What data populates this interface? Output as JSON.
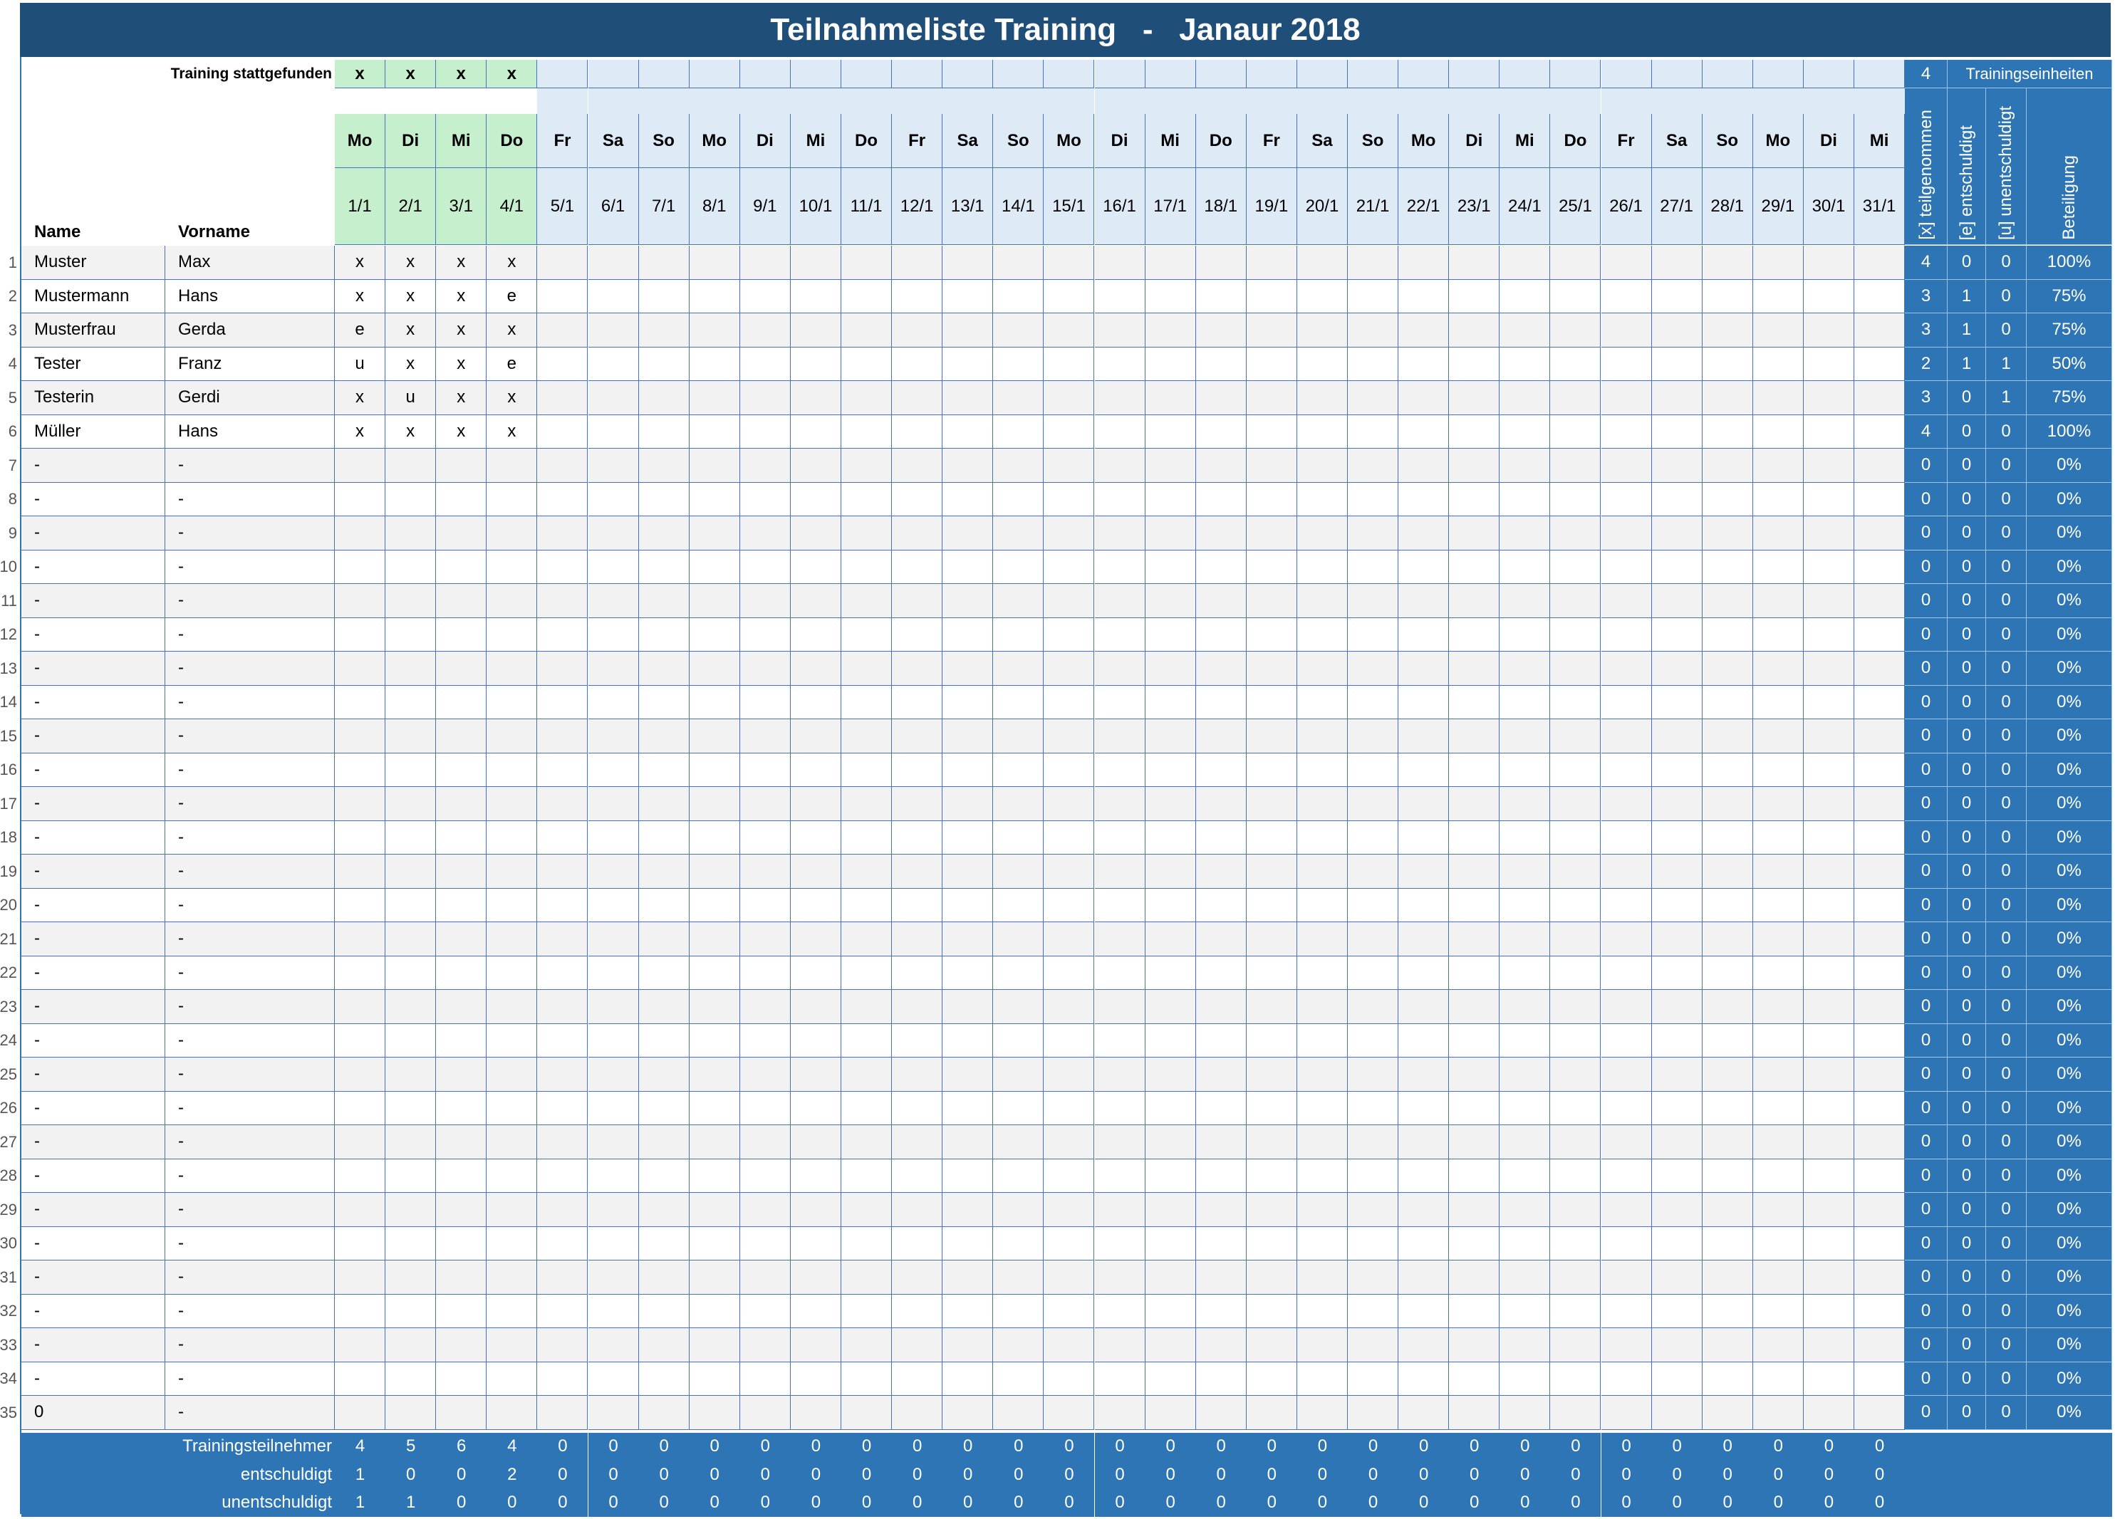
{
  "title": "Teilnahmeliste Training   -   Janaur 2018",
  "header": {
    "training_held_label": "Training stattgefunden",
    "training_units_count": "4",
    "training_units_label": "Trainingseinheiten",
    "name_label": "Name",
    "firstname_label": "Vorname"
  },
  "held_marks": [
    "x",
    "x",
    "x",
    "x"
  ],
  "weekdays": [
    "Mo",
    "Di",
    "Mi",
    "Do",
    "Fr",
    "Sa",
    "So",
    "Mo",
    "Di",
    "Mi",
    "Do",
    "Fr",
    "Sa",
    "So",
    "Mo",
    "Di",
    "Mi",
    "Do",
    "Fr",
    "Sa",
    "So",
    "Mo",
    "Di",
    "Mi",
    "Do",
    "Fr",
    "Sa",
    "So",
    "Mo",
    "Di",
    "Mi"
  ],
  "dates": [
    "1/1",
    "2/1",
    "3/1",
    "4/1",
    "5/1",
    "6/1",
    "7/1",
    "8/1",
    "9/1",
    "10/1",
    "11/1",
    "12/1",
    "13/1",
    "14/1",
    "15/1",
    "16/1",
    "17/1",
    "18/1",
    "19/1",
    "20/1",
    "21/1",
    "22/1",
    "23/1",
    "24/1",
    "25/1",
    "26/1",
    "27/1",
    "28/1",
    "29/1",
    "30/1",
    "31/1"
  ],
  "summary_headers": [
    "[x] teilgenommen",
    "[e] entschuldigt",
    "[u] unentschuldigt",
    "Beteiligung"
  ],
  "rows": [
    {
      "num": "1",
      "name": "Muster",
      "first": "Max",
      "marks": [
        "x",
        "x",
        "x",
        "x"
      ],
      "x": "4",
      "e": "0",
      "u": "0",
      "pct": "100%"
    },
    {
      "num": "2",
      "name": "Mustermann",
      "first": "Hans",
      "marks": [
        "x",
        "x",
        "x",
        "e"
      ],
      "x": "3",
      "e": "1",
      "u": "0",
      "pct": "75%"
    },
    {
      "num": "3",
      "name": "Musterfrau",
      "first": "Gerda",
      "marks": [
        "e",
        "x",
        "x",
        "x"
      ],
      "x": "3",
      "e": "1",
      "u": "0",
      "pct": "75%"
    },
    {
      "num": "4",
      "name": "Tester",
      "first": "Franz",
      "marks": [
        "u",
        "x",
        "x",
        "e"
      ],
      "x": "2",
      "e": "1",
      "u": "1",
      "pct": "50%"
    },
    {
      "num": "5",
      "name": "Testerin",
      "first": "Gerdi",
      "marks": [
        "x",
        "u",
        "x",
        "x"
      ],
      "x": "3",
      "e": "0",
      "u": "1",
      "pct": "75%"
    },
    {
      "num": "6",
      "name": "Müller",
      "first": "Hans",
      "marks": [
        "x",
        "x",
        "x",
        "x"
      ],
      "x": "4",
      "e": "0",
      "u": "0",
      "pct": "100%"
    },
    {
      "num": "7",
      "name": "-",
      "first": "-",
      "marks": [],
      "x": "0",
      "e": "0",
      "u": "0",
      "pct": "0%"
    },
    {
      "num": "8",
      "name": "-",
      "first": "-",
      "marks": [],
      "x": "0",
      "e": "0",
      "u": "0",
      "pct": "0%"
    },
    {
      "num": "9",
      "name": "-",
      "first": "-",
      "marks": [],
      "x": "0",
      "e": "0",
      "u": "0",
      "pct": "0%"
    },
    {
      "num": "10",
      "name": "-",
      "first": "-",
      "marks": [],
      "x": "0",
      "e": "0",
      "u": "0",
      "pct": "0%"
    },
    {
      "num": "11",
      "name": "-",
      "first": "-",
      "marks": [],
      "x": "0",
      "e": "0",
      "u": "0",
      "pct": "0%"
    },
    {
      "num": "12",
      "name": "-",
      "first": "-",
      "marks": [],
      "x": "0",
      "e": "0",
      "u": "0",
      "pct": "0%"
    },
    {
      "num": "13",
      "name": "-",
      "first": "-",
      "marks": [],
      "x": "0",
      "e": "0",
      "u": "0",
      "pct": "0%"
    },
    {
      "num": "14",
      "name": "-",
      "first": "-",
      "marks": [],
      "x": "0",
      "e": "0",
      "u": "0",
      "pct": "0%"
    },
    {
      "num": "15",
      "name": "-",
      "first": "-",
      "marks": [],
      "x": "0",
      "e": "0",
      "u": "0",
      "pct": "0%"
    },
    {
      "num": "16",
      "name": "-",
      "first": "-",
      "marks": [],
      "x": "0",
      "e": "0",
      "u": "0",
      "pct": "0%"
    },
    {
      "num": "17",
      "name": "-",
      "first": "-",
      "marks": [],
      "x": "0",
      "e": "0",
      "u": "0",
      "pct": "0%"
    },
    {
      "num": "18",
      "name": "-",
      "first": "-",
      "marks": [],
      "x": "0",
      "e": "0",
      "u": "0",
      "pct": "0%"
    },
    {
      "num": "19",
      "name": "-",
      "first": "-",
      "marks": [],
      "x": "0",
      "e": "0",
      "u": "0",
      "pct": "0%"
    },
    {
      "num": "20",
      "name": "-",
      "first": "-",
      "marks": [],
      "x": "0",
      "e": "0",
      "u": "0",
      "pct": "0%"
    },
    {
      "num": "21",
      "name": "-",
      "first": "-",
      "marks": [],
      "x": "0",
      "e": "0",
      "u": "0",
      "pct": "0%"
    },
    {
      "num": "22",
      "name": "-",
      "first": "-",
      "marks": [],
      "x": "0",
      "e": "0",
      "u": "0",
      "pct": "0%"
    },
    {
      "num": "23",
      "name": "-",
      "first": "-",
      "marks": [],
      "x": "0",
      "e": "0",
      "u": "0",
      "pct": "0%"
    },
    {
      "num": "24",
      "name": "-",
      "first": "-",
      "marks": [],
      "x": "0",
      "e": "0",
      "u": "0",
      "pct": "0%"
    },
    {
      "num": "25",
      "name": "-",
      "first": "-",
      "marks": [],
      "x": "0",
      "e": "0",
      "u": "0",
      "pct": "0%"
    },
    {
      "num": "26",
      "name": "-",
      "first": "-",
      "marks": [],
      "x": "0",
      "e": "0",
      "u": "0",
      "pct": "0%"
    },
    {
      "num": "27",
      "name": "-",
      "first": "-",
      "marks": [],
      "x": "0",
      "e": "0",
      "u": "0",
      "pct": "0%"
    },
    {
      "num": "28",
      "name": "-",
      "first": "-",
      "marks": [],
      "x": "0",
      "e": "0",
      "u": "0",
      "pct": "0%"
    },
    {
      "num": "29",
      "name": "-",
      "first": "-",
      "marks": [],
      "x": "0",
      "e": "0",
      "u": "0",
      "pct": "0%"
    },
    {
      "num": "30",
      "name": "-",
      "first": "-",
      "marks": [],
      "x": "0",
      "e": "0",
      "u": "0",
      "pct": "0%"
    },
    {
      "num": "31",
      "name": "-",
      "first": "-",
      "marks": [],
      "x": "0",
      "e": "0",
      "u": "0",
      "pct": "0%"
    },
    {
      "num": "32",
      "name": "-",
      "first": "-",
      "marks": [],
      "x": "0",
      "e": "0",
      "u": "0",
      "pct": "0%"
    },
    {
      "num": "33",
      "name": "-",
      "first": "-",
      "marks": [],
      "x": "0",
      "e": "0",
      "u": "0",
      "pct": "0%"
    },
    {
      "num": "34",
      "name": "-",
      "first": "-",
      "marks": [],
      "x": "0",
      "e": "0",
      "u": "0",
      "pct": "0%"
    },
    {
      "num": "35",
      "name": "0",
      "first": "-",
      "marks": [],
      "x": "0",
      "e": "0",
      "u": "0",
      "pct": "0%"
    }
  ],
  "footer": [
    {
      "label": "Trainingsteilnehmer",
      "values": [
        "4",
        "5",
        "6",
        "4",
        "0",
        "0",
        "0",
        "0",
        "0",
        "0",
        "0",
        "0",
        "0",
        "0",
        "0",
        "0",
        "0",
        "0",
        "0",
        "0",
        "0",
        "0",
        "0",
        "0",
        "0",
        "0",
        "0",
        "0",
        "0",
        "0",
        "0"
      ]
    },
    {
      "label": "entschuldigt",
      "values": [
        "1",
        "0",
        "0",
        "2",
        "0",
        "0",
        "0",
        "0",
        "0",
        "0",
        "0",
        "0",
        "0",
        "0",
        "0",
        "0",
        "0",
        "0",
        "0",
        "0",
        "0",
        "0",
        "0",
        "0",
        "0",
        "0",
        "0",
        "0",
        "0",
        "0",
        "0"
      ]
    },
    {
      "label": "unentschuldigt",
      "values": [
        "1",
        "1",
        "0",
        "0",
        "0",
        "0",
        "0",
        "0",
        "0",
        "0",
        "0",
        "0",
        "0",
        "0",
        "0",
        "0",
        "0",
        "0",
        "0",
        "0",
        "0",
        "0",
        "0",
        "0",
        "0",
        "0",
        "0",
        "0",
        "0",
        "0",
        "0"
      ]
    }
  ],
  "colors": {
    "title_bg": "#1f4e79",
    "accent": "#2e75b6",
    "grid_line": "#4472c4",
    "header_light": "#deebf7",
    "held_green": "#c6efce",
    "row_alt": "#f2f2f2"
  }
}
